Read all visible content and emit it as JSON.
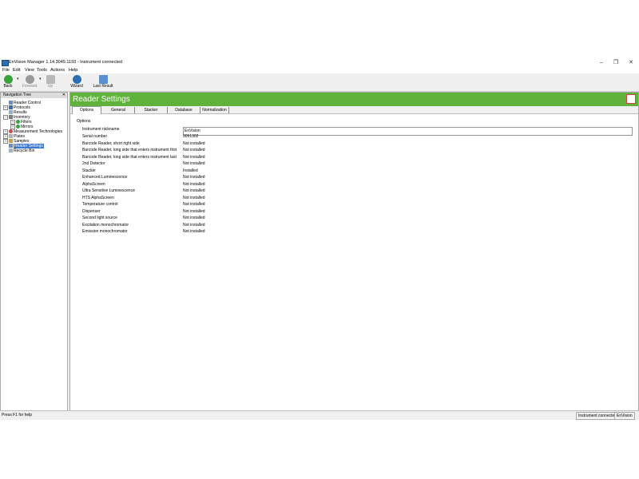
{
  "window": {
    "title": "EnVision Manager 1.14.3049.1193 - Instrument connected",
    "controls": {
      "minimize": "–",
      "maximize": "❐",
      "close": "✕"
    }
  },
  "menu": [
    "File",
    "Edit",
    "View",
    "Tools",
    "Actions",
    "Help"
  ],
  "toolbar": {
    "back": "Back",
    "forward": "Forward",
    "up": "Up",
    "wizard": "Wizard",
    "last_result": "Last Result"
  },
  "nav": {
    "header": "Navigation Tree",
    "close": "✕",
    "items": [
      {
        "label": "Reader Control"
      },
      {
        "label": "Protocols"
      },
      {
        "label": "Results"
      },
      {
        "label": "Inventory"
      },
      {
        "label": "Filters"
      },
      {
        "label": "Mirrors"
      },
      {
        "label": "Measurement Technologies"
      },
      {
        "label": "Plates"
      },
      {
        "label": "Samples"
      },
      {
        "label": "Reader Settings"
      },
      {
        "label": "Recycle Bin"
      }
    ]
  },
  "main": {
    "title": "Reader Settings",
    "tabs": [
      "Options",
      "General",
      "Stacker",
      "Database",
      "Normalization"
    ],
    "section": "Options",
    "nickname_label": "Instrument nickname",
    "nickname_value": "EnVision",
    "rows": [
      {
        "label": "Serial number",
        "value": "3051302"
      },
      {
        "label": "Barcode Reader, short right side",
        "value": "Not installed"
      },
      {
        "label": "Barcode Reader, long side that enters instrument first",
        "value": "Not installed"
      },
      {
        "label": "Barcode Reader, long side that enters instrument last",
        "value": "Not installed"
      },
      {
        "label": "2nd Detector",
        "value": "Not installed"
      },
      {
        "label": "Stacker",
        "value": "Installed"
      },
      {
        "label": "Enhanced Luminescence",
        "value": "Not installed"
      },
      {
        "label": "AlphaScreen",
        "value": "Not installed"
      },
      {
        "label": "Ultra Sensitive Luminescence",
        "value": "Not installed"
      },
      {
        "label": "HTS AlphaScreen",
        "value": "Not installed"
      },
      {
        "label": "Temperature control",
        "value": "Not installed"
      },
      {
        "label": "Dispenser",
        "value": "Not installed"
      },
      {
        "label": "Second light source",
        "value": "Not installed"
      },
      {
        "label": "Excitation monochromator",
        "value": "Not installed"
      },
      {
        "label": "Emission monochromator",
        "value": "Not installed"
      }
    ]
  },
  "status": {
    "help": "Press F1 for help",
    "connection": "Instrument connected",
    "instrument": "EnVision"
  },
  "colors": {
    "banner": "#5fb33c",
    "selection": "#3a78d2"
  }
}
